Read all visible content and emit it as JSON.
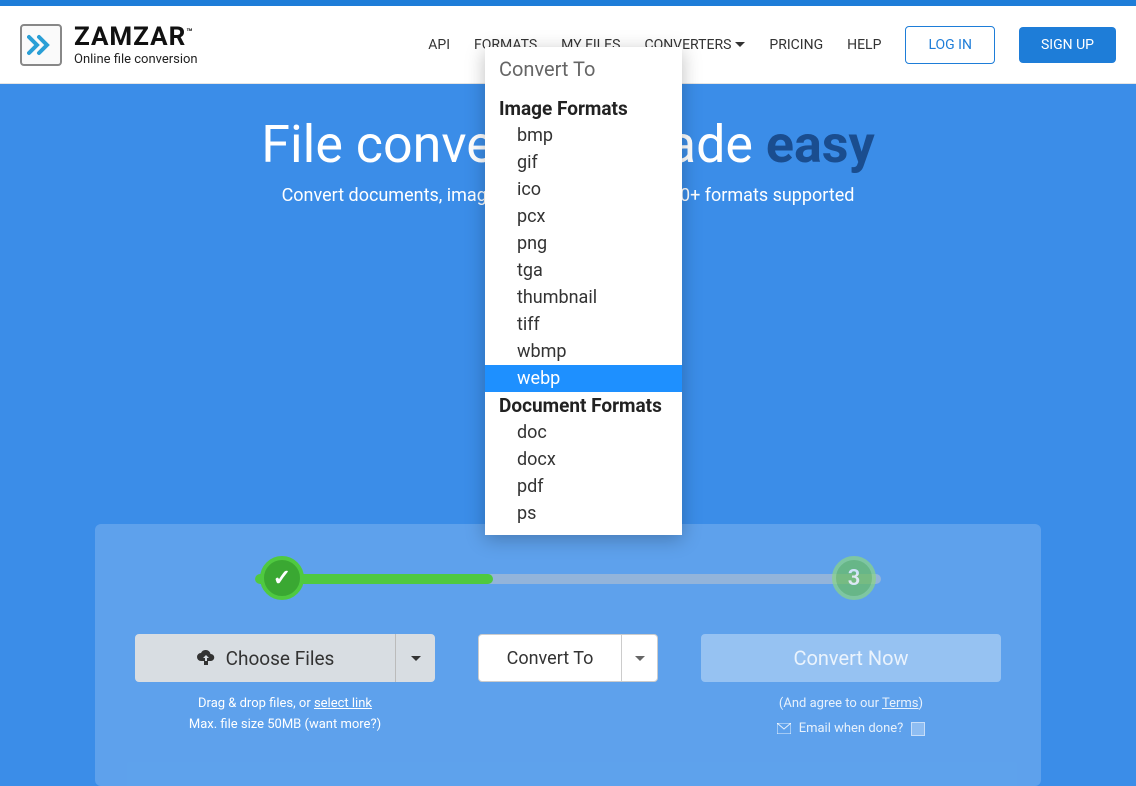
{
  "brand": {
    "name": "ZAMZAR",
    "tm": "™",
    "tagline": "Online file conversion"
  },
  "nav": {
    "api": "API",
    "formats": "FORMATS",
    "myfiles": "MY FILES",
    "converters": "CONVERTERS",
    "pricing": "PRICING",
    "help": "HELP",
    "login": "LOG IN",
    "signup": "SIGN UP"
  },
  "hero": {
    "title_pre": "File conversion made ",
    "title_em": "easy",
    "subtitle": "Convert documents, images, videos & sound - 1100+ formats supported"
  },
  "steps": {
    "s1": "✓",
    "s3": "3"
  },
  "actions": {
    "choose": "Choose Files",
    "drag_hint_pre": "Drag & drop files, or ",
    "drag_hint_link": "select link",
    "max_pre": "Max. file size 50MB (",
    "max_link": "want more?",
    "max_post": ")",
    "convert_to": "Convert To",
    "convert_now": "Convert Now",
    "agree_pre": "(And agree to our ",
    "agree_link": "Terms",
    "agree_post": ")",
    "email_done": "Email when done?"
  },
  "dropdown": {
    "title": "Convert To",
    "group_image": "Image Formats",
    "group_document": "Document Formats",
    "image_formats": [
      "bmp",
      "gif",
      "ico",
      "pcx",
      "png",
      "tga",
      "thumbnail",
      "tiff",
      "wbmp",
      "webp"
    ],
    "document_formats": [
      "doc",
      "docx",
      "pdf",
      "ps"
    ],
    "selected": "webp"
  }
}
